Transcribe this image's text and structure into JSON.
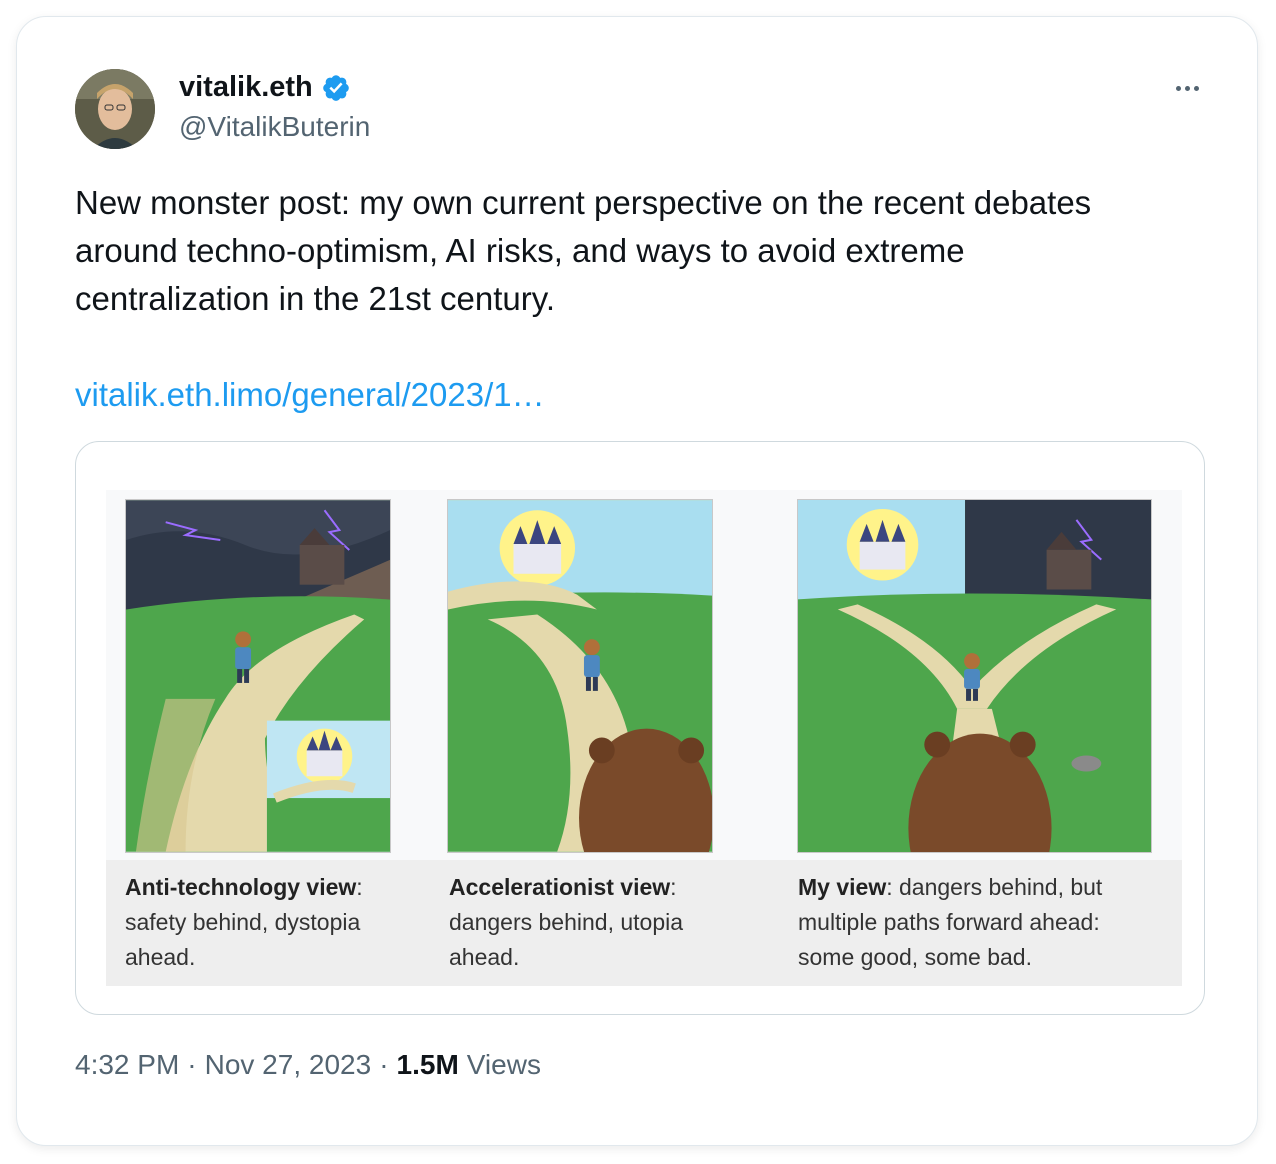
{
  "author": {
    "display_name": "vitalik.eth",
    "handle": "@VitalikButerin",
    "verified": true
  },
  "tweet": {
    "text": "New monster post: my own current perspective on the recent debates\naround techno-optimism, AI risks, and ways to avoid extreme\ncentralization in the 21st century.",
    "link": "vitalik.eth.limo/general/2023/1…"
  },
  "media": {
    "panels": [
      {
        "caption_bold": "Anti-technology view",
        "caption_rest": ": safety behind, dystopia ahead."
      },
      {
        "caption_bold": "Accelerationist view",
        "caption_rest": ": dangers behind, utopia ahead."
      },
      {
        "caption_bold": "My view",
        "caption_rest": ": dangers behind, but multiple paths forward ahead: some good, some bad."
      }
    ]
  },
  "meta": {
    "time": "4:32 PM",
    "separator": "·",
    "date": "Nov 27, 2023",
    "views_count": "1.5M",
    "views_label": "Views"
  },
  "colors": {
    "text": "#0f1419",
    "secondary": "#536471",
    "link": "#1d9bf0",
    "verified": "#1d9bf0"
  },
  "icons": {
    "verified": "verified-badge-icon",
    "more": "more-options-icon"
  }
}
